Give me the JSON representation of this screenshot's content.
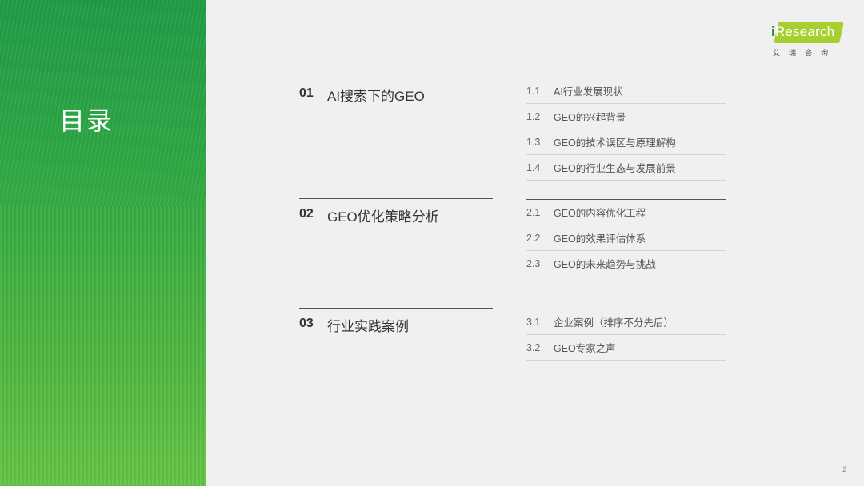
{
  "side": {
    "title": "目录"
  },
  "logo": {
    "brand": "Research",
    "brand_i": "i",
    "sub": "艾瑞咨询"
  },
  "sections": [
    {
      "num": "01",
      "title": "AI搜索下的GEO",
      "items": [
        {
          "num": "1.1",
          "label": "AI行业发展现状"
        },
        {
          "num": "1.2",
          "label": "GEO的兴起背景"
        },
        {
          "num": "1.3",
          "label": "GEO的技术误区与原理解构"
        },
        {
          "num": "1.4",
          "label": "GEO的行业生态与发展前景"
        }
      ]
    },
    {
      "num": "02",
      "title": "GEO优化策略分析",
      "items": [
        {
          "num": "2.1",
          "label": "GEO的内容优化工程"
        },
        {
          "num": "2.2",
          "label": "GEO的效果评估体系"
        },
        {
          "num": "2.3",
          "label": "GEO的未来趋势与挑战"
        }
      ]
    },
    {
      "num": "03",
      "title": "行业实践案例",
      "items": [
        {
          "num": "3.1",
          "label": "企业案例（排序不分先后）"
        },
        {
          "num": "3.2",
          "label": "GEO专家之声"
        }
      ]
    }
  ],
  "page_number": "2",
  "colors": {
    "green_dark": "#1f9a45",
    "green_light": "#62c242",
    "logo_badge": "#a8cf2f"
  }
}
